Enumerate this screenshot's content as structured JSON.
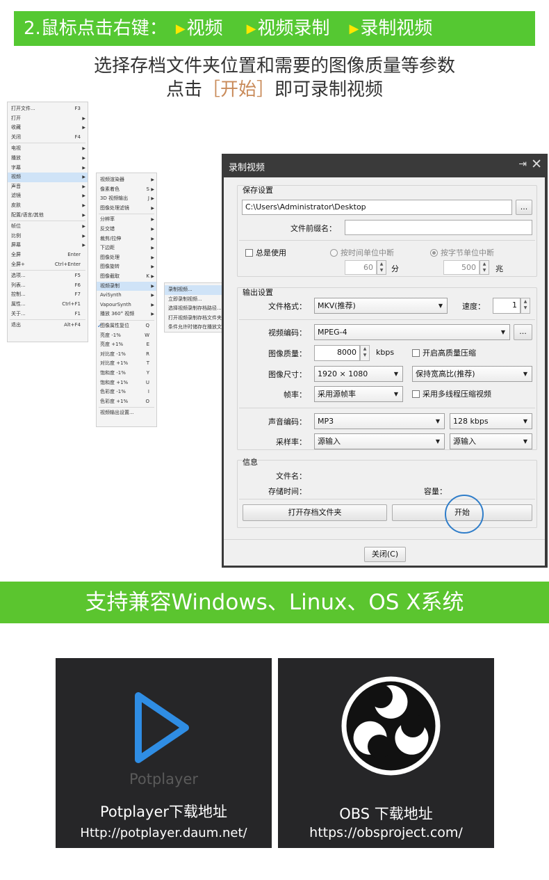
{
  "step_banner": {
    "prefix": "2.鼠标点击右键：",
    "path": [
      "视频",
      "视频录制",
      "录制视频"
    ]
  },
  "subtitle": {
    "line1": "选择存档文件夹位置和需要的图像质量等参数",
    "line2_pre": "点击",
    "line2_bracket": "［开始］",
    "line2_post": "即可录制视频"
  },
  "main_menu": {
    "items": [
      {
        "label": "打开文件...",
        "shortcut": "F3"
      },
      {
        "label": "打开",
        "arrow": true
      },
      {
        "label": "收藏",
        "arrow": true
      },
      {
        "label": "关闭",
        "shortcut": "F4"
      },
      {
        "label": "电视",
        "arrow": true
      },
      {
        "label": "播放",
        "arrow": true
      },
      {
        "label": "字幕",
        "arrow": true
      },
      {
        "label": "视频",
        "arrow": true,
        "highlight": true
      },
      {
        "label": "声音",
        "arrow": true
      },
      {
        "label": "滤镜",
        "arrow": true
      },
      {
        "label": "皮肤",
        "arrow": true
      },
      {
        "label": "配置/语言/其他",
        "arrow": true
      },
      {
        "label": "帧位",
        "arrow": true
      },
      {
        "label": "比例",
        "arrow": true
      },
      {
        "label": "屏幕",
        "arrow": true
      },
      {
        "label": "全屏",
        "shortcut": "Enter"
      },
      {
        "label": "全屏+",
        "shortcut": "Ctrl+Enter"
      },
      {
        "label": "选项...",
        "shortcut": "F5"
      },
      {
        "label": "列表...",
        "shortcut": "F6"
      },
      {
        "label": "控制...",
        "shortcut": "F7"
      },
      {
        "label": "属性...",
        "shortcut": "Ctrl+F1"
      },
      {
        "label": "关于...",
        "shortcut": "F1"
      },
      {
        "label": "退出",
        "shortcut": "Alt+F4"
      }
    ]
  },
  "video_menu": {
    "items": [
      {
        "label": "视频渲染器",
        "arrow": true
      },
      {
        "label": "像素着色",
        "shortcut": "S",
        "arrow": true
      },
      {
        "label": "3D 视频输出",
        "shortcut": "J",
        "arrow": true
      },
      {
        "label": "图像处理滤镜",
        "arrow": true
      },
      {
        "label": "分辨率",
        "arrow": true
      },
      {
        "label": "反交错",
        "arrow": true
      },
      {
        "label": "裁剪/拉伸",
        "arrow": true
      },
      {
        "label": "下边距",
        "arrow": true
      },
      {
        "label": "图像处理",
        "arrow": true
      },
      {
        "label": "图像旋转",
        "arrow": true
      },
      {
        "label": "图像截取",
        "shortcut": "K",
        "arrow": true
      },
      {
        "label": "视频录制",
        "arrow": true,
        "highlight": true
      },
      {
        "label": "AviSynth",
        "arrow": true
      },
      {
        "label": "VapourSynth",
        "arrow": true
      },
      {
        "label": "播放 360° 视频",
        "arrow": true
      },
      {
        "label": "图像属性复位",
        "shortcut": "Q",
        "check": true
      },
      {
        "label": "亮度 -1%",
        "shortcut": "W"
      },
      {
        "label": "亮度 +1%",
        "shortcut": "E"
      },
      {
        "label": "对比度 -1%",
        "shortcut": "R"
      },
      {
        "label": "对比度 +1%",
        "shortcut": "T"
      },
      {
        "label": "饱和度 -1%",
        "shortcut": "Y"
      },
      {
        "label": "饱和度 +1%",
        "shortcut": "U"
      },
      {
        "label": "色彩度 -1%",
        "shortcut": "I"
      },
      {
        "label": "色彩度 +1%",
        "shortcut": "O"
      },
      {
        "label": "视频输出设置..."
      }
    ]
  },
  "record_menu": {
    "items": [
      {
        "label": "录制视频...",
        "highlight": true
      },
      {
        "label": "立即录制视频..."
      },
      {
        "label": "选择视频录制存档路径..."
      },
      {
        "label": "打开视频录制存档文件夹..."
      },
      {
        "label": "条件允许时储存在播放文件夹..."
      }
    ]
  },
  "dialog": {
    "title": "录制视频",
    "save_group": {
      "title": "保存设置",
      "path": "C:\\Users\\Administrator\\Desktop",
      "browse_label": "...",
      "prefix_label": "文件前缀名：",
      "prefix_value": "",
      "always_use_label": "总是使用",
      "split_by_time_label": "按时间单位中断",
      "split_by_time_value": "60",
      "split_by_time_unit": "分",
      "split_by_size_label": "按字节单位中断",
      "split_by_size_value": "500",
      "split_by_size_unit": "兆"
    },
    "output_group": {
      "title": "输出设置",
      "format_label": "文件格式：",
      "format_value": "MKV(推荐)",
      "speed_label": "速度：",
      "speed_value": "1",
      "video_codec_label": "视频编码：",
      "video_codec_value": "MPEG-4",
      "codec_more_label": "...",
      "quality_label": "图像质量：",
      "quality_value": "8000",
      "quality_unit": "kbps",
      "hq_compress_label": "开启高质量压缩",
      "size_label": "图像尺寸：",
      "size_value": "1920 × 1080",
      "aspect_value": "保持宽高比(推荐)",
      "fps_label": "帧率：",
      "fps_value": "采用源帧率",
      "multithread_label": "采用多线程压缩视频",
      "audio_codec_label": "声音编码：",
      "audio_codec_value": "MP3",
      "audio_bitrate_value": "128 kbps",
      "sample_rate_label": "采样率：",
      "sample_rate_value": "源输入",
      "channel_value": "源输入"
    },
    "info_group": {
      "title": "信息",
      "filename_label": "文件名：",
      "duration_label": "存储时间：",
      "capacity_label": "容量：",
      "open_folder_label": "打开存档文件夹",
      "start_label": "开始"
    },
    "close_label": "关闭(C)"
  },
  "compat_banner": "支持兼容Windows、Linux、OS X系统",
  "cards": [
    {
      "logo_text": "Potplayer",
      "title": "Potplayer下载地址",
      "url": "Http://potplayer.daum.net/"
    },
    {
      "title": "OBS 下载地址",
      "url": "https://obsproject.com/"
    }
  ],
  "colors": {
    "banner_green": "#55c832",
    "arrow_yellow": "#ffe600",
    "highlight_circle": "#2f7dc9",
    "potplayer_blue": "#2f8de4"
  }
}
